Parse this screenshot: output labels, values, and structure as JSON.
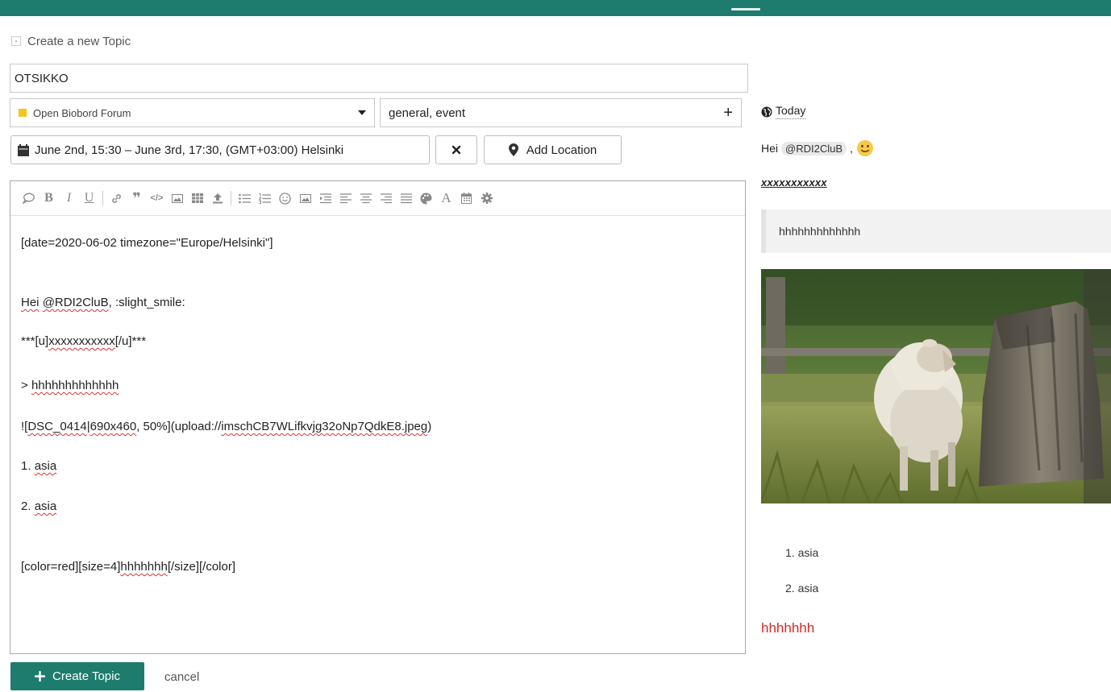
{
  "composer": {
    "header_label": "Create a new Topic",
    "title_value": "OTSIKKO",
    "category": {
      "label": "Open Biobord Forum",
      "color": "#f5c518"
    },
    "tags": "general, event",
    "event_date": "June 2nd, 15:30 – June 3rd, 17:30, (GMT+03:00) Helsinki",
    "add_location_label": "Add Location",
    "create_label": "Create Topic",
    "cancel_label": "cancel",
    "accent_color": "#1d7c6d"
  },
  "editor": {
    "toolbar_icons": [
      "comment-icon",
      "bold-icon",
      "italic-icon",
      "underline-icon",
      "link-icon",
      "quote-icon",
      "code-icon",
      "image-icon",
      "table-icon",
      "upload-icon",
      "bullet-list-icon",
      "numbered-list-icon",
      "emoji-icon",
      "gallery-icon",
      "indent-icon",
      "align-left-icon",
      "align-center-icon",
      "align-right-icon",
      "justify-icon",
      "palette-icon",
      "font-size-icon",
      "calendar-icon",
      "gear-icon"
    ],
    "lines": {
      "date": "[date=2020-06-02 timezone=\"Europe/Helsinki\"]",
      "hei_prefix": "Hei ",
      "hei_mention": "@RDI2CluB",
      "hei_suffix": ", :slight_smile:",
      "u_prefix": "***[u]",
      "u_word": "xxxxxxxxxxx",
      "u_suffix": "[/u]***",
      "quote_prefix": "> ",
      "quote_word": "hhhhhhhhhhhhh",
      "img_a": "![",
      "img_b": "DSC_0414",
      "img_c": "|",
      "img_d": "690x460",
      "img_e": ", 50%](upload://",
      "img_f": "imschCB7WLifkvjg32oNp7QdkE8.jpeg",
      "img_g": ")",
      "li1_prefix": "1. ",
      "li1_word": "asia",
      "li2_prefix": "2. ",
      "li2_word": "asia",
      "color_a": "[color=red][size=4]",
      "color_b": "hhhhhhh",
      "color_c": "[/size][/color]"
    }
  },
  "preview": {
    "today": "Today",
    "hei": "Hei",
    "mention": "@RDI2CluB",
    "comma": ",",
    "underline_text": "xxxxxxxxxxx",
    "quote": "hhhhhhhhhhhhh",
    "list": [
      "1. asia",
      "2. asia"
    ],
    "red_text": "hhhhhhh",
    "red_color": "#d62828"
  }
}
